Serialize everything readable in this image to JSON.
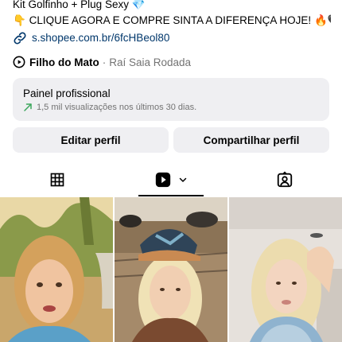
{
  "bio": {
    "line1": "Kit Golfinho + Plug Sexy",
    "line1_emoji": "💎",
    "line2_emoji": "👇",
    "line2": "CLIQUE AGORA E COMPRE SINTA A DIFERENÇA HOJE!",
    "line2_end_emoji": "🔥🖤",
    "link": "s.shopee.com.br/6fcHBeol80"
  },
  "music": {
    "title": "Filho do Mato",
    "separator": "·",
    "artist": "Raí Saia Rodada"
  },
  "panel": {
    "title": "Painel profissional",
    "subtitle": "1,5 mil visualizações nos últimos 30 dias."
  },
  "buttons": {
    "edit": "Editar perfil",
    "share": "Compartilhar perfil"
  },
  "tabs": {
    "active": "reels",
    "icons": [
      "grid-icon",
      "reels-icon",
      "tagged-icon"
    ]
  },
  "colors": {
    "link": "#00376b",
    "secondary_text": "#737373",
    "panel_bg": "#efeff2",
    "trend_green": "#3aa65b"
  }
}
